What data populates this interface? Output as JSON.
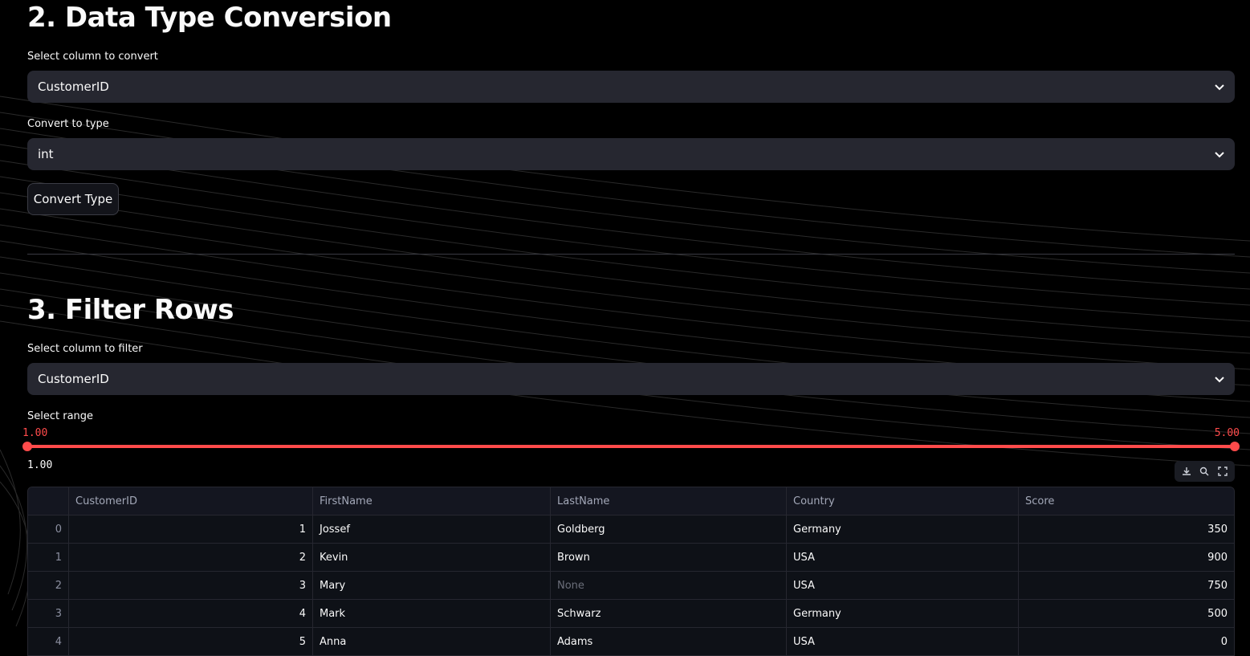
{
  "section2": {
    "title": "2. Data Type Conversion",
    "column_label": "Select column to convert",
    "column_value": "CustomerID",
    "type_label": "Convert to type",
    "type_value": "int",
    "convert_button": "Convert Type"
  },
  "section3": {
    "title": "3. Filter Rows",
    "column_label": "Select column to filter",
    "column_value": "CustomerID",
    "range_label": "Select range",
    "range_min": "1.00",
    "range_max": "5.00",
    "range_min_fraction": 0.0,
    "range_max_fraction": 1.0,
    "below_value": "1.00"
  },
  "accent_color": "#ff4b4b",
  "table": {
    "columns": [
      "",
      "CustomerID",
      "FirstName",
      "LastName",
      "Country",
      "Score"
    ],
    "rows": [
      {
        "idx": "0",
        "id": "1",
        "first": "Jossef",
        "last": "Goldberg",
        "country": "Germany",
        "score": "350"
      },
      {
        "idx": "1",
        "id": "2",
        "first": "Kevin",
        "last": "Brown",
        "country": "USA",
        "score": "900"
      },
      {
        "idx": "2",
        "id": "3",
        "first": "Mary",
        "last": "None",
        "country": "USA",
        "score": "750"
      },
      {
        "idx": "3",
        "id": "4",
        "first": "Mark",
        "last": "Schwarz",
        "country": "Germany",
        "score": "500"
      },
      {
        "idx": "4",
        "id": "5",
        "first": "Anna",
        "last": "Adams",
        "country": "USA",
        "score": "0"
      }
    ]
  },
  "toolbar_icons": [
    "download-icon",
    "search-icon",
    "fullscreen-icon"
  ]
}
